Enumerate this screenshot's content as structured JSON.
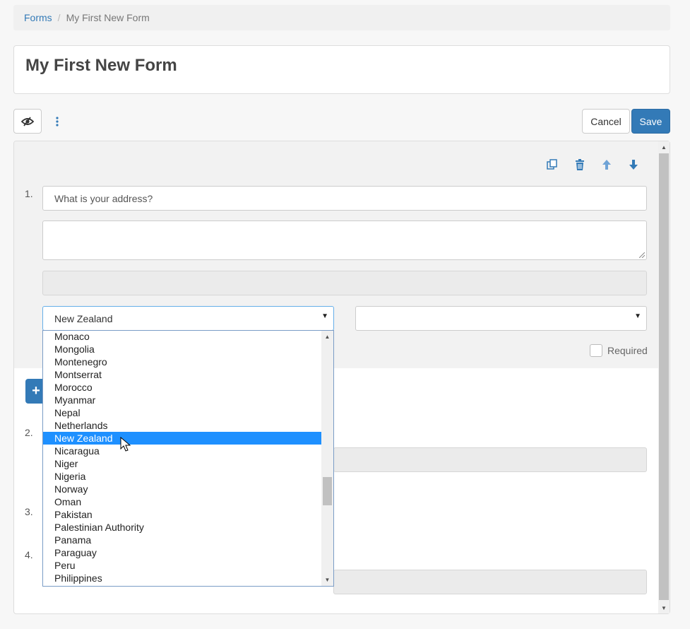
{
  "breadcrumb": {
    "parent": "Forms",
    "separator": "/",
    "current": "My First New Form"
  },
  "form_title": "My First New Form",
  "toolbar": {
    "preview_icon": "eye-slash-icon",
    "more_icon": "kebab-vertical-icon",
    "cancel_label": "Cancel",
    "save_label": "Save"
  },
  "question_actions": [
    "duplicate-icon",
    "trash-icon",
    "arrow-up-icon",
    "arrow-down-icon"
  ],
  "questions": [
    {
      "number": "1.",
      "title_value": "What is your address?",
      "country_select": "New Zealand",
      "required_label": "Required"
    },
    {
      "number": "2."
    },
    {
      "number": "3."
    },
    {
      "number": "4."
    }
  ],
  "add_button_icon": "+",
  "country_dropdown": {
    "options": [
      "Monaco",
      "Mongolia",
      "Montenegro",
      "Montserrat",
      "Morocco",
      "Myanmar",
      "Nepal",
      "Netherlands",
      "New Zealand",
      "Nicaragua",
      "Niger",
      "Nigeria",
      "Norway",
      "Oman",
      "Pakistan",
      "Palestinian Authority",
      "Panama",
      "Paraguay",
      "Peru",
      "Philippines"
    ],
    "selected": "New Zealand"
  },
  "colors": {
    "primary": "#337ab7",
    "highlight": "#1e90ff"
  }
}
